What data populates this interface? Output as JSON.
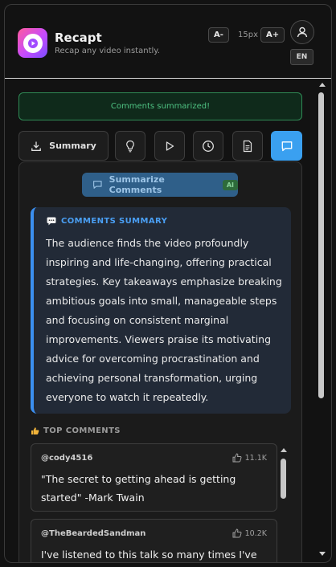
{
  "app": {
    "title": "Recapt",
    "subtitle": "Recap any video instantly."
  },
  "header": {
    "font_decrease_label": "A-",
    "font_size": "15px",
    "font_increase_label": "A+",
    "language": "EN"
  },
  "status": {
    "message": "Comments summarized!",
    "color": "#4fc383"
  },
  "toolbar": {
    "summary_label": "Summary",
    "active_tool": "comments",
    "accent": "#3aa0f0",
    "icons": [
      "download-icon",
      "lightbulb-icon",
      "play-icon",
      "clock-icon",
      "document-icon",
      "chat-bubble-icon"
    ]
  },
  "summarize_button": {
    "label": "Summarize Comments",
    "badge": "AI"
  },
  "comments_summary": {
    "heading": "COMMENTS SUMMARY",
    "body": "The audience finds the video profoundly inspiring and life-changing, offering practical strategies. Key takeaways emphasize breaking ambitious goals into small, manageable steps and focusing on consistent marginal improvements. Viewers praise its motivating advice for overcoming procrastination and achieving personal transformation, urging everyone to watch it repeatedly."
  },
  "top_comments": {
    "heading": "TOP COMMENTS",
    "items": [
      {
        "user": "@cody4516",
        "likes": "11.1K",
        "text": "\"The secret to getting ahead is getting started\" -Mark Twain"
      },
      {
        "user": "@TheBeardedSandman",
        "likes": "10.2K",
        "text": "I've listened to this talk so many times I've lost"
      }
    ]
  }
}
